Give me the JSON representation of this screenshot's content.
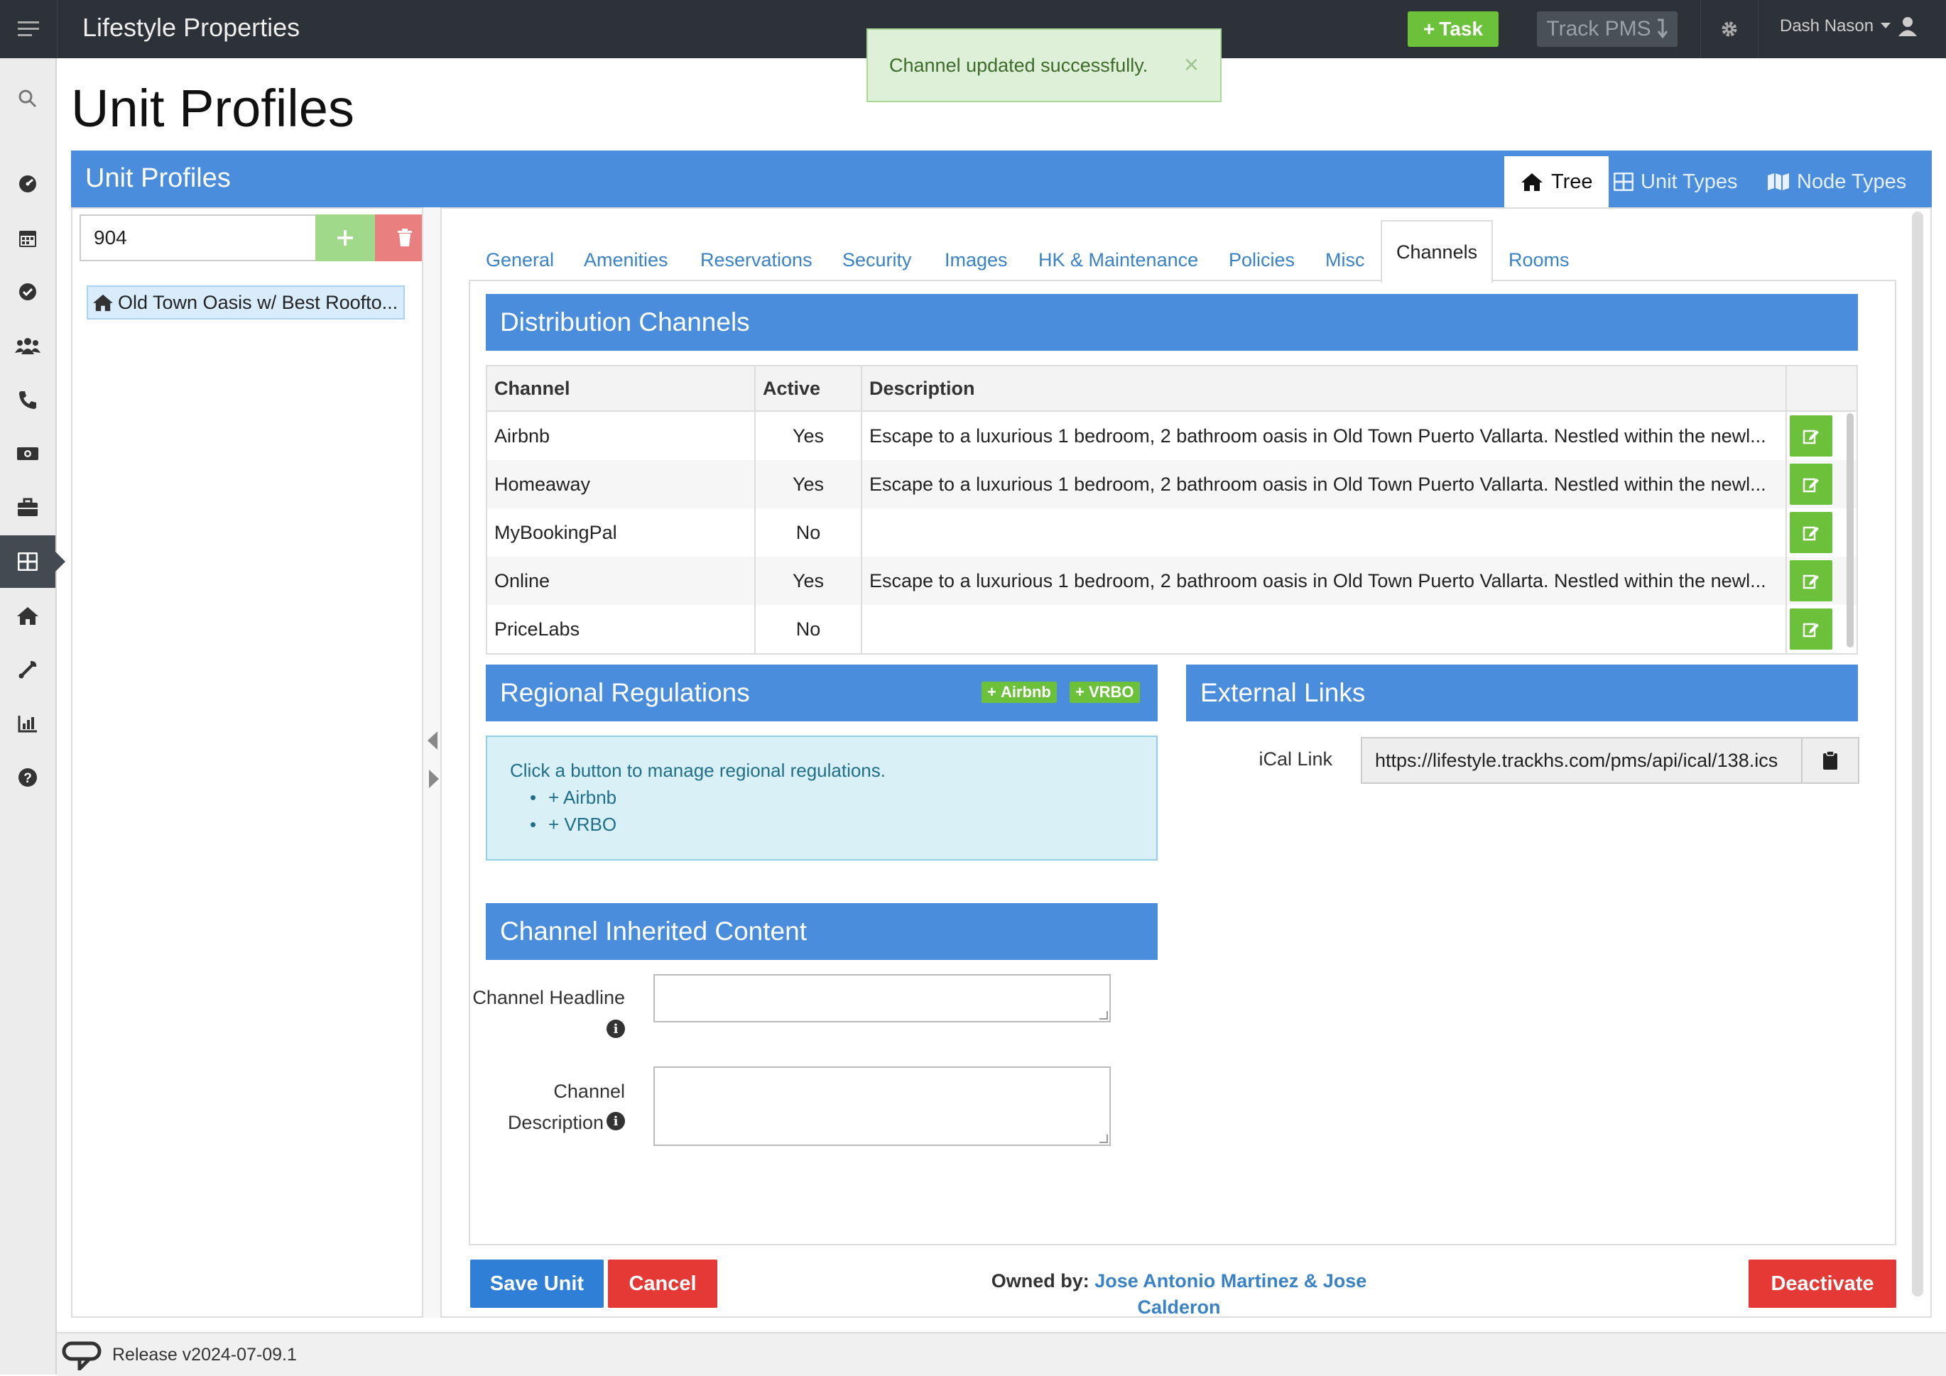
{
  "app": {
    "title": "Lifestyle Properties",
    "task_label": "Task",
    "trackpms_label": "Track PMS",
    "user_name": "Dash Nason"
  },
  "nav": {
    "icons": [
      "search-icon",
      "dashboard-icon",
      "calendar-icon",
      "check-circle-icon",
      "users-icon",
      "phone-icon",
      "money-icon",
      "briefcase-icon",
      "grid-icon",
      "home-icon",
      "wrench-icon",
      "chart-icon",
      "help-icon"
    ],
    "active": "grid-icon"
  },
  "toast": {
    "message": "Channel updated successfully.",
    "close": "×"
  },
  "page": {
    "title": "Unit Profiles"
  },
  "panel": {
    "title": "Unit Profiles",
    "header_tabs": [
      {
        "label": "Tree",
        "icon": "home-icon",
        "active": true
      },
      {
        "label": "Unit Types",
        "icon": "table-icon",
        "active": false
      },
      {
        "label": "Node Types",
        "icon": "map-icon",
        "active": false
      }
    ]
  },
  "tree": {
    "search_value": "904",
    "node_label": "Old Town Oasis w/ Best Roofto..."
  },
  "tabs": [
    {
      "label": "General"
    },
    {
      "label": "Amenities"
    },
    {
      "label": "Reservations"
    },
    {
      "label": "Security"
    },
    {
      "label": "Images"
    },
    {
      "label": "HK & Maintenance"
    },
    {
      "label": "Policies"
    },
    {
      "label": "Misc"
    },
    {
      "label": "Channels",
      "active": true
    },
    {
      "label": "Rooms"
    }
  ],
  "channels": {
    "title": "Distribution Channels",
    "headers": [
      "Channel",
      "Active",
      "Description"
    ],
    "rows": [
      {
        "channel": "Airbnb",
        "active": "Yes",
        "description": "Escape to a luxurious 1 bedroom, 2 bathroom oasis in Old Town Puerto Vallarta. Nestled within the newl..."
      },
      {
        "channel": "Homeaway",
        "active": "Yes",
        "description": "Escape to a luxurious 1 bedroom, 2 bathroom oasis in Old Town Puerto Vallarta. Nestled within the newl..."
      },
      {
        "channel": "MyBookingPal",
        "active": "No",
        "description": ""
      },
      {
        "channel": "Online",
        "active": "Yes",
        "description": "Escape to a luxurious 1 bedroom, 2 bathroom oasis in Old Town Puerto Vallarta. Nestled within the newl..."
      },
      {
        "channel": "PriceLabs",
        "active": "No",
        "description": ""
      }
    ]
  },
  "regional": {
    "title": "Regional Regulations",
    "btn_airbnb": "Airbnb",
    "btn_vrbo": "VRBO",
    "info": "Click a button to manage regional regulations.",
    "links": [
      "Airbnb",
      "VRBO"
    ]
  },
  "external": {
    "title": "External Links",
    "ical_label": "iCal Link",
    "ical_value": "https://lifestyle.trackhs.com/pms/api/ical/138.ics"
  },
  "inherited": {
    "title": "Channel Inherited Content",
    "headline_label": "Channel Headline",
    "description_label_1": "Channel",
    "description_label_2": "Description"
  },
  "footer": {
    "save": "Save Unit",
    "cancel": "Cancel",
    "owned_prefix": "Owned by:",
    "owner": "Jose Antonio Martinez & Jose Calderon",
    "deactivate": "Deactivate"
  },
  "status": {
    "release": "Release v2024-07-09.1"
  },
  "colors": {
    "brand_blue": "#4a8ddc",
    "success_green": "#6cc13a",
    "danger_red": "#e53935",
    "save_blue": "#2f7fd6",
    "topbar": "#2d3238"
  }
}
